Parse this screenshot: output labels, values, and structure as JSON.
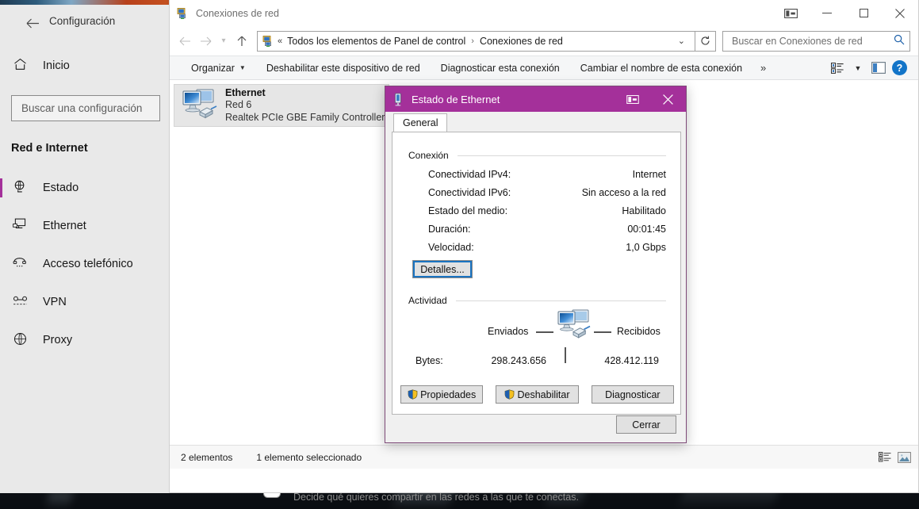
{
  "settings": {
    "title": "Configuración",
    "back_icon": "back-arrow-icon",
    "home": {
      "label": "Inicio",
      "icon": "home-icon"
    },
    "search": {
      "placeholder": "Buscar una configuración",
      "value": ""
    },
    "section_title": "Red e Internet",
    "nav_items": [
      {
        "label": "Estado",
        "icon": "status-globe-icon",
        "selected": true
      },
      {
        "label": "Ethernet",
        "icon": "ethernet-icon",
        "selected": false
      },
      {
        "label": "Acceso telefónico",
        "icon": "dialup-phone-icon",
        "selected": false
      },
      {
        "label": "VPN",
        "icon": "vpn-icon",
        "selected": false
      },
      {
        "label": "Proxy",
        "icon": "proxy-globe-icon",
        "selected": false
      }
    ],
    "background_text": "Decide qué quieres compartir en las redes a las que te conectas.",
    "accent_color": "#A4309A"
  },
  "explorer": {
    "title": "Conexiones de red",
    "app_icon": "network-connections-icon",
    "window_buttons": {
      "restore_group": "task-view-icon",
      "minimize": "minimize-icon",
      "maximize": "maximize-icon",
      "close": "close-icon"
    },
    "nav": {
      "back": "back-arrow-icon",
      "forward": "forward-arrow-icon",
      "recent": "chevron-down-icon",
      "up": "up-arrow-icon"
    },
    "breadcrumb": {
      "icon": "network-connections-icon",
      "overflow": "«",
      "crumbs": [
        "Todos los elementos de Panel de control",
        "Conexiones de red"
      ],
      "separator": "›",
      "dropdown": "chevron-down-icon"
    },
    "refresh": "refresh-icon",
    "search": {
      "placeholder": "Buscar en Conexiones de red",
      "value": "",
      "icon": "search-icon"
    },
    "commands": [
      {
        "label": "Organizar",
        "has_caret": true
      },
      {
        "label": "Deshabilitar este dispositivo de red",
        "has_caret": false
      },
      {
        "label": "Diagnosticar esta conexión",
        "has_caret": false
      },
      {
        "label": "Cambiar el nombre de esta conexión",
        "has_caret": false
      },
      {
        "label": "»",
        "has_caret": false
      }
    ],
    "toolbar_right": {
      "view_icon": "view-options-icon",
      "view_caret": "chevron-down-icon",
      "preview_icon": "preview-pane-icon",
      "help_icon": "help-icon",
      "help_label": "?"
    },
    "connection": {
      "name": "Ethernet",
      "network": "Red 6",
      "adapter": "Realtek PCIe GBE Family Controller",
      "icon": "network-adapter-icon"
    },
    "status": {
      "items_count": "2 elementos",
      "selection": "1 elemento seleccionado",
      "view_details_icon": "details-view-icon",
      "view_large_icon": "large-icons-view-icon"
    }
  },
  "ethernet_dialog": {
    "title": "Estado de Ethernet",
    "title_icon": "ethernet-status-icon",
    "titlebar_buttons": {
      "snap": "task-view-icon",
      "close": "close-icon"
    },
    "tabs": [
      {
        "label": "General",
        "active": true
      }
    ],
    "connection_group": {
      "label": "Conexión",
      "rows": [
        {
          "key": "Conectividad IPv4:",
          "value": "Internet"
        },
        {
          "key": "Conectividad IPv6:",
          "value": "Sin acceso a la red"
        },
        {
          "key": "Estado del medio:",
          "value": "Habilitado"
        },
        {
          "key": "Duración:",
          "value": "00:01:45"
        },
        {
          "key": "Velocidad:",
          "value": "1,0 Gbps"
        }
      ],
      "details_button": "Detalles..."
    },
    "activity_group": {
      "label": "Actividad",
      "sent_label": "Enviados",
      "received_label": "Recibidos",
      "bytes_label": "Bytes:",
      "sent_value": "298.243.656",
      "received_value": "428.412.119",
      "icon": "computers-transfer-icon"
    },
    "action_buttons": [
      {
        "label": "Propiedades",
        "shield": true
      },
      {
        "label": "Deshabilitar",
        "shield": true
      },
      {
        "label": "Diagnosticar",
        "shield": false
      }
    ],
    "close_button": "Cerrar",
    "accent_color": "#A4309A"
  }
}
